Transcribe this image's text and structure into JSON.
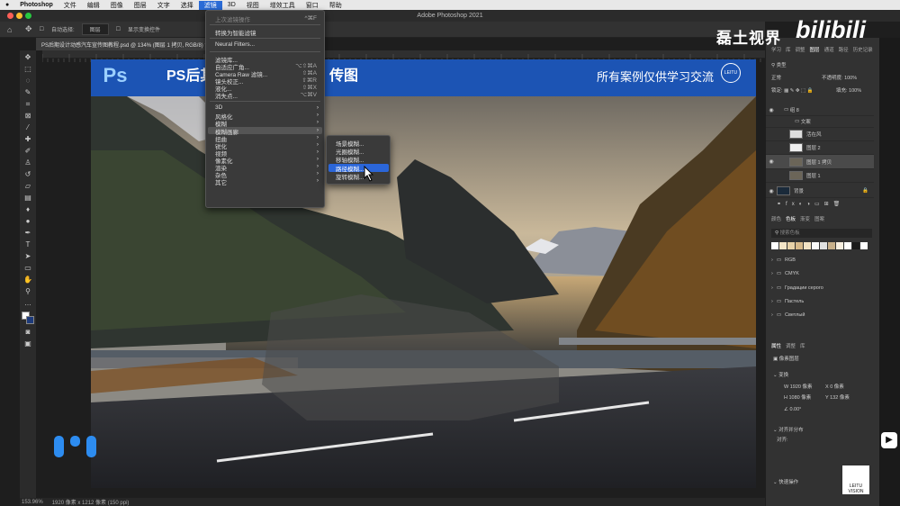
{
  "menubar": {
    "apple": "",
    "items": [
      "Photoshop",
      "文件",
      "编辑",
      "图像",
      "图层",
      "文字",
      "选择",
      "滤镜",
      "3D",
      "视图",
      "增效工具",
      "窗口",
      "帮助"
    ],
    "active_index": 7
  },
  "titlebar": {
    "title": "Adobe Photoshop 2021"
  },
  "options": {
    "auto_select": "自动选择:",
    "layer": "图层",
    "show_transform": "显示变换控件"
  },
  "doc_tab": {
    "label": "PS后期设计动感汽车宣传图教程.psd @ 134% (图层 1 拷贝, RGB/8) *"
  },
  "canvas": {
    "ps_logo": "Ps",
    "banner_title_left": "PS后其",
    "banner_title_right": "传图",
    "banner_right": "所有案例仅供学习交流",
    "badge": "LEITU"
  },
  "filter_menu": {
    "last_filter": "上次滤镜操作",
    "last_shortcut": "^⌘F",
    "smart": "转换为智能滤镜",
    "neural": "Neural Filters...",
    "items": [
      {
        "label": "滤镜库...",
        "shortcut": ""
      },
      {
        "label": "自适应广角...",
        "shortcut": "⌥⇧⌘A"
      },
      {
        "label": "Camera Raw 滤镜...",
        "shortcut": "⇧⌘A"
      },
      {
        "label": "镜头校正...",
        "shortcut": "⇧⌘R"
      },
      {
        "label": "液化...",
        "shortcut": "⇧⌘X"
      },
      {
        "label": "消失点...",
        "shortcut": "⌥⌘V"
      }
    ],
    "submenus": [
      "3D",
      "风格化",
      "模糊",
      "模糊画廊",
      "扭曲",
      "锐化",
      "视频",
      "像素化",
      "渲染",
      "杂色",
      "其它"
    ],
    "highlighted": "模糊画廊"
  },
  "blur_gallery": {
    "items": [
      "场景模糊...",
      "光圈模糊...",
      "移轴模糊...",
      "路径模糊...",
      "旋转模糊..."
    ],
    "highlighted": "路径模糊..."
  },
  "watermark": {
    "text": "磊土视界",
    "logo": "bilibili"
  },
  "right_panel": {
    "top_tabs": [
      "学习",
      "库",
      "调整",
      "图层",
      "通道",
      "路径",
      "历史记录"
    ],
    "kind_label": "类型",
    "blend_mode": "正常",
    "opacity_label": "不透明度:",
    "opacity": "100%",
    "lock_label": "锁定:",
    "fill_label": "填充:",
    "fill": "100%",
    "layers": [
      {
        "name": "组 8"
      },
      {
        "name": "文案"
      },
      {
        "name": "活在风"
      },
      {
        "name": "图层 2"
      },
      {
        "name": "图层 1 拷贝"
      },
      {
        "name": "图层 1"
      },
      {
        "name": "背景"
      }
    ],
    "swatch_tabs": [
      "颜色",
      "色板",
      "渐变",
      "图案"
    ],
    "swatch_search": "搜索色板",
    "swatch_groups": [
      "RGB",
      "CMYK",
      "Градации серого",
      "Пастель",
      "Светлый"
    ],
    "props_tabs": [
      "属性",
      "调整",
      "库"
    ],
    "props_type": "像素图层",
    "transform_label": "变换",
    "w": "1920 像素",
    "x": "0 像素",
    "h": "1080 像素",
    "y": "132 像素",
    "angle": "0.00°",
    "align_label": "对齐并分布",
    "align_sub": "对齐:",
    "quick_label": "快速操作"
  },
  "statusbar": {
    "zoom": "153.96%",
    "doc": "1920 像素 x 1212 像素 (150 ppi)"
  },
  "badge_br": {
    "line1": "LEITU",
    "line2": "VISION"
  }
}
